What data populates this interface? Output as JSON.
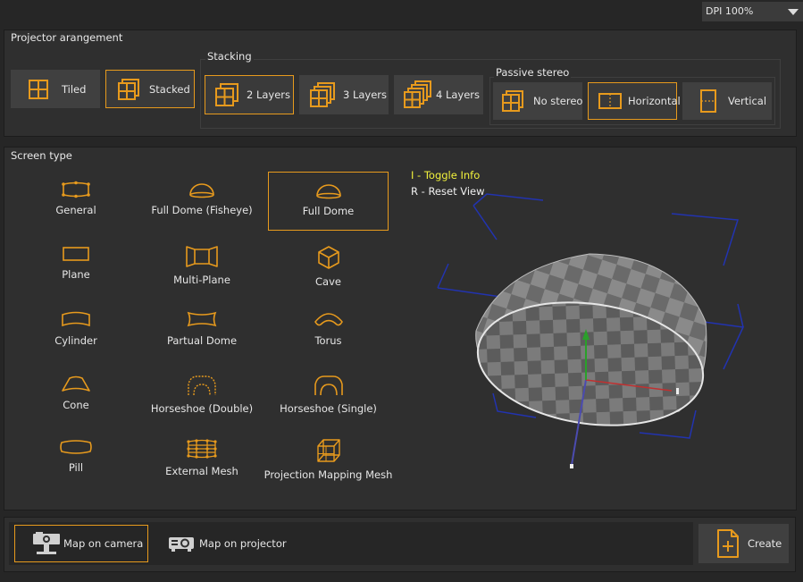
{
  "dpi": {
    "value": "DPI 100%"
  },
  "projector": {
    "title": "Projector arangement",
    "tiled_label": "Tiled",
    "stacked_label": "Stacked"
  },
  "stacking": {
    "title": "Stacking",
    "layers2_label": "2 Layers",
    "layers3_label": "3 Layers",
    "layers4_label": "4 Layers"
  },
  "stereo": {
    "title": "Passive stereo",
    "none_label": "No stereo",
    "horizontal_label": "Horizontal",
    "vertical_label": "Vertical"
  },
  "screen_type": {
    "title": "Screen type",
    "items": [
      {
        "label": "General",
        "icon": "general-icon"
      },
      {
        "label": "Full Dome (Fisheye)",
        "icon": "dome-fisheye-icon"
      },
      {
        "label": "Full Dome",
        "icon": "dome-icon"
      },
      {
        "label": "Plane",
        "icon": "plane-icon"
      },
      {
        "label": "Multi-Plane",
        "icon": "multi-plane-icon"
      },
      {
        "label": "Cave",
        "icon": "cave-icon"
      },
      {
        "label": "Cylinder",
        "icon": "cylinder-icon"
      },
      {
        "label": "Partual Dome",
        "icon": "partial-dome-icon"
      },
      {
        "label": "Torus",
        "icon": "torus-icon"
      },
      {
        "label": "Cone",
        "icon": "cone-icon"
      },
      {
        "label": "Horseshoe (Double)",
        "icon": "horseshoe-double-icon"
      },
      {
        "label": "Horseshoe (Single)",
        "icon": "horseshoe-single-icon"
      },
      {
        "label": "Pill",
        "icon": "pill-icon"
      },
      {
        "label": "External Mesh",
        "icon": "external-mesh-icon"
      },
      {
        "label": "Projection Mapping Mesh",
        "icon": "projection-mapping-mesh-icon"
      }
    ],
    "selected": "Full Dome"
  },
  "preview": {
    "toggle_info": "I - Toggle Info",
    "reset_view": "R - Reset View"
  },
  "bottom": {
    "map_camera_label": "Map on camera",
    "map_projector_label": "Map on projector",
    "create_label": "Create"
  },
  "colors": {
    "accent": "#e79a1d",
    "panel": "#2f2f2f",
    "button": "#404040",
    "info_yellow": "#f2f23c"
  }
}
